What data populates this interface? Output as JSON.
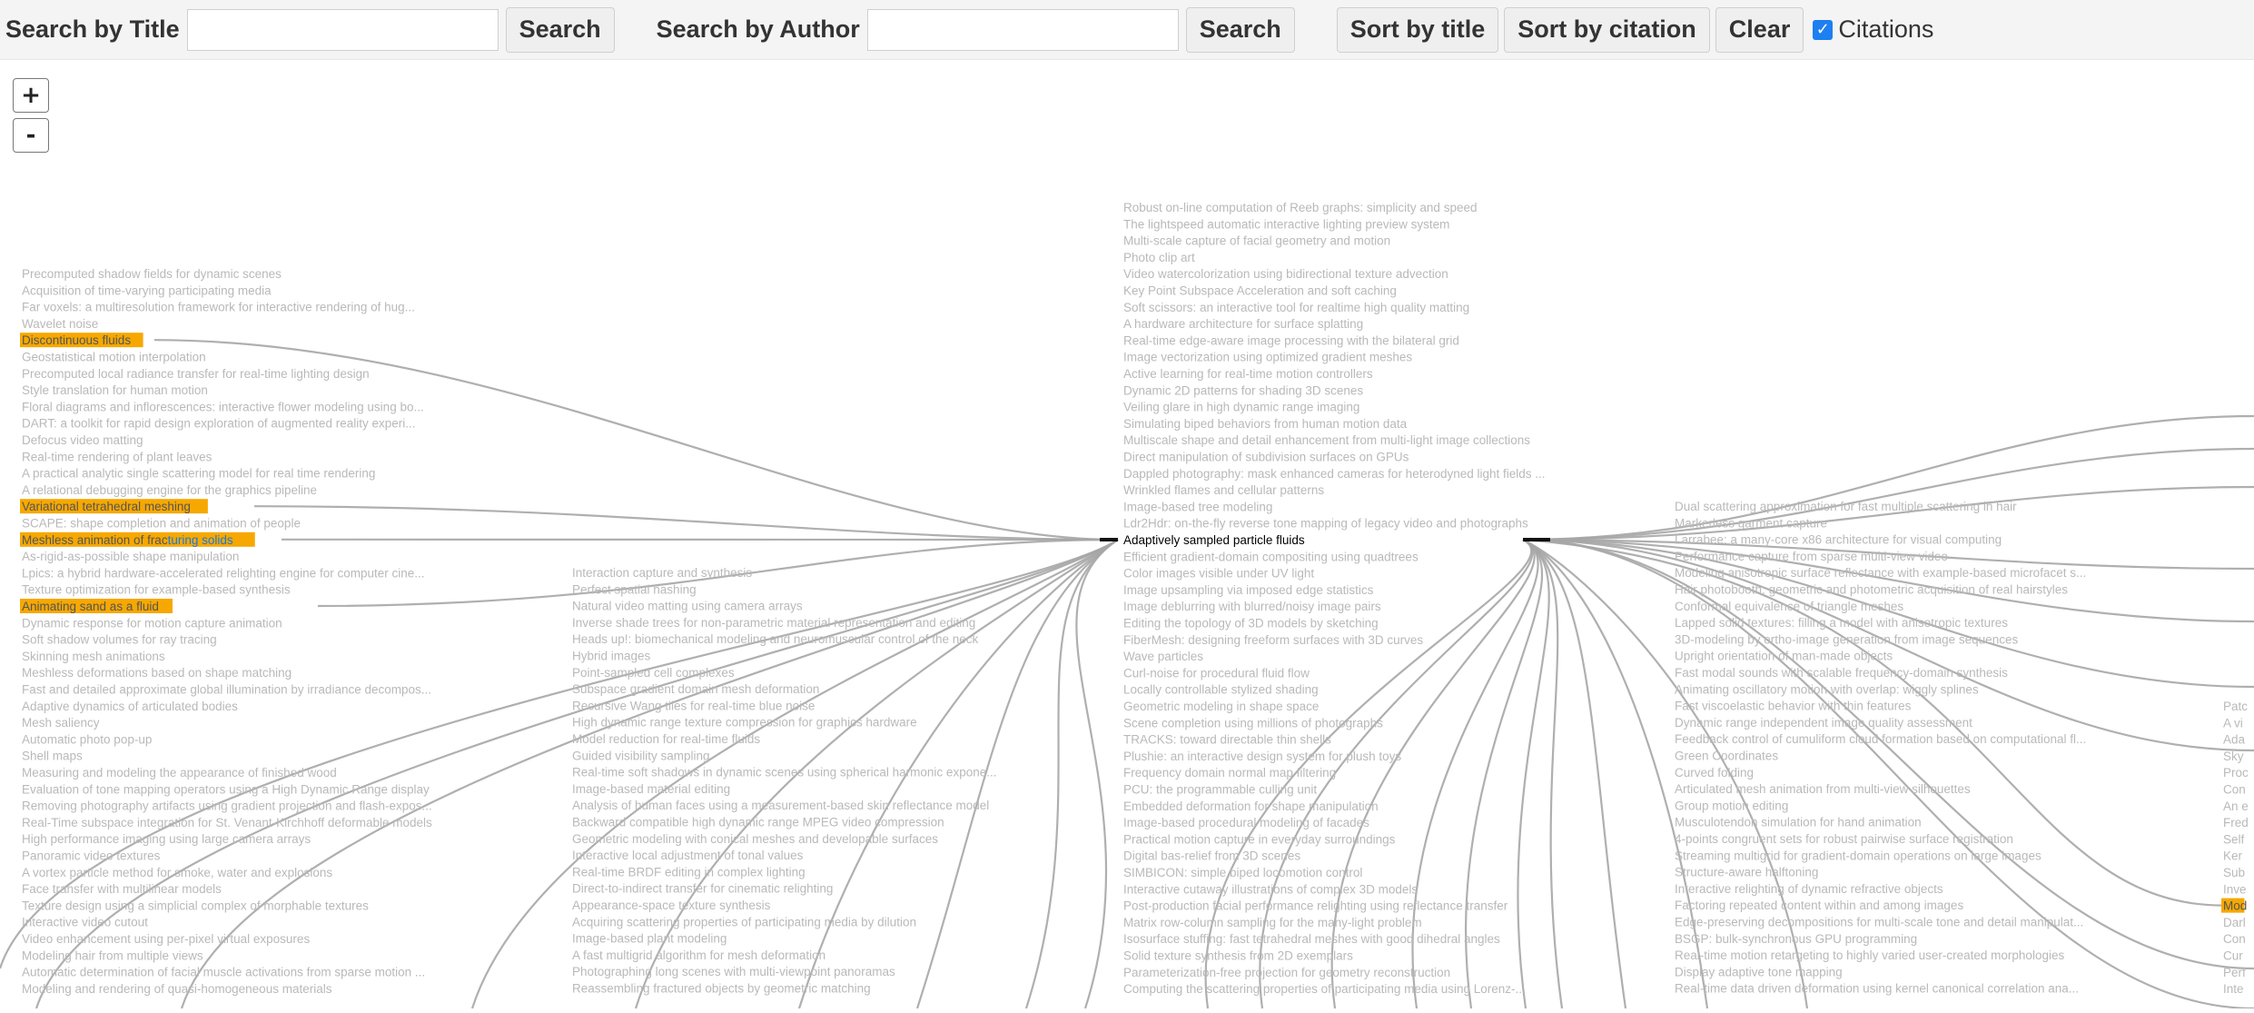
{
  "toolbar": {
    "title_label": "Search by Title",
    "title_value": "",
    "title_button": "Search",
    "author_label": "Search by Author",
    "author_value": "",
    "author_button": "Search",
    "sort_title": "Sort by title",
    "sort_citation": "Sort by citation",
    "clear": "Clear",
    "citations_checked": true,
    "citations_label": "Citations"
  },
  "zoom": {
    "in": "+",
    "out": "-"
  },
  "colors": {
    "text_gray": "#b9b9b9",
    "edge_gray": "#a6a6a6",
    "highlight": "#f7a800",
    "link_blue": "#1a7ad9",
    "center_edge": "#000000"
  },
  "graph": {
    "center": {
      "title": "Adaptively sampled particle fluids"
    },
    "columns": [
      {
        "id": "col1",
        "items": [
          "Precomputed shadow fields for dynamic scenes",
          "Acquisition of time-varying participating media",
          "Far voxels: a multiresolution framework for interactive rendering of hug...",
          "Wavelet noise",
          "Discontinuous fluids",
          "Geostatistical motion interpolation",
          "Precomputed local radiance transfer for real-time lighting design",
          "Style translation for human motion",
          "Floral diagrams and inflorescences: interactive flower modeling using bo...",
          "DART: a toolkit for rapid design exploration of augmented reality experi...",
          "Defocus video matting",
          "Real-time rendering of plant leaves",
          "A practical analytic single scattering model for real time rendering",
          "A relational debugging engine for the graphics pipeline",
          "Variational tetrahedral meshing",
          "SCAPE: shape completion and animation of people",
          "Meshless animation of fracturing solids",
          "As-rigid-as-possible shape manipulation",
          "Lpics: a hybrid hardware-accelerated relighting engine for computer cine...",
          "Texture optimization for example-based synthesis",
          "Animating sand as a fluid",
          "Dynamic response for motion capture animation",
          "Soft shadow volumes for ray tracing",
          "Skinning mesh animations",
          "Meshless deformations based on shape matching",
          "Fast and detailed approximate global illumination by irradiance decompos...",
          "Adaptive dynamics of articulated bodies",
          "Mesh saliency",
          "Automatic photo pop-up",
          "Shell maps",
          "Measuring and modeling the appearance of finished wood",
          "Evaluation of tone mapping operators using a High Dynamic Range display",
          "Removing photography artifacts using gradient projection and flash-expos...",
          "Real-Time subspace integration for St. Venant-Kirchhoff deformable models",
          "High performance imaging using large camera arrays",
          "Panoramic video textures",
          "A vortex particle method for smoke, water and explosions",
          "Face transfer with multilinear models",
          "Texture design using a simplicial complex of morphable textures",
          "Interactive video cutout",
          "Video enhancement using per-pixel virtual exposures",
          "Modeling hair from multiple views",
          "Automatic determination of facial muscle activations from sparse motion ...",
          "Modeling and rendering of quasi-homogeneous materials"
        ],
        "highlighted": [
          4,
          14,
          16,
          20
        ],
        "cited_link": {
          "index": 16,
          "prefix": "Meshless animation of frac",
          "suffix": "turing solids"
        }
      },
      {
        "id": "col2",
        "items": [
          "Interaction capture and synthesis",
          "Perfect spatial hashing",
          "Natural video matting using camera arrays",
          "Inverse shade trees for non-parametric material representation and editing",
          "Heads up!: biomechanical modeling and neuromuscular control of the neck",
          "Hybrid images",
          "Point-sampled cell complexes",
          "Subspace gradient domain mesh deformation",
          "Recursive Wang tiles for real-time blue noise",
          "High dynamic range texture compression for graphics hardware",
          "Model reduction for real-time fluids",
          "Guided visibility sampling",
          "Real-time soft shadows in dynamic scenes using spherical harmonic expone...",
          "Image-based material editing",
          "Analysis of human faces using a measurement-based skin reflectance model",
          "Backward compatible high dynamic range MPEG video compression",
          "Geometric modeling with conical meshes and developable surfaces",
          "Interactive local adjustment of tonal values",
          "Real-time BRDF editing in complex lighting",
          "Direct-to-indirect transfer for cinematic relighting",
          "Appearance-space texture synthesis",
          "Acquiring scattering properties of participating media by dilution",
          "Image-based plant modeling",
          "A fast multigrid algorithm for mesh deformation",
          "Photographing long scenes with multi-viewpoint panoramas",
          "Reassembling fractured objects by geometric matching"
        ]
      },
      {
        "id": "col3",
        "items": [
          "Robust on-line computation of Reeb graphs: simplicity and speed",
          "The lightspeed automatic interactive lighting preview system",
          "Multi-scale capture of facial geometry and motion",
          "Photo clip art",
          "Video watercolorization using bidirectional texture advection",
          "Key Point Subspace Acceleration and soft caching",
          "Soft scissors: an interactive tool for realtime high quality matting",
          "A hardware architecture for surface splatting",
          "Real-time edge-aware image processing with the bilateral grid",
          "Image vectorization using optimized gradient meshes",
          "Active learning for real-time motion controllers",
          "Dynamic 2D patterns for shading 3D scenes",
          "Veiling glare in high dynamic range imaging",
          "Simulating biped behaviors from human motion data",
          "Multiscale shape and detail enhancement from multi-light image collections",
          "Direct manipulation of subdivision surfaces on GPUs",
          "Dappled photography: mask enhanced cameras for heterodyned light fields ...",
          "Wrinkled flames and cellular patterns",
          "Image-based tree modeling",
          "Ldr2Hdr: on-the-fly reverse tone mapping of legacy video and photographs",
          "Adaptively sampled particle fluids",
          "Efficient gradient-domain compositing using quadtrees",
          "Color images visible under UV light",
          "Image upsampling via imposed edge statistics",
          "Image deblurring with blurred/noisy image pairs",
          "Editing the topology of 3D models by sketching",
          "FiberMesh: designing freeform surfaces with 3D curves",
          "Wave particles",
          "Curl-noise for procedural fluid flow",
          "Locally controllable stylized shading",
          "Geometric modeling in shape space",
          "Scene completion using millions of photographs",
          "TRACKS: toward directable thin shells",
          "Plushie: an interactive design system for plush toys",
          "Frequency domain normal map filtering",
          "PCU: the programmable culling unit",
          "Embedded deformation for shape manipulation",
          "Image-based procedural modeling of facades",
          "Practical motion capture in everyday surroundings",
          "Digital bas-relief from 3D scenes",
          "SIMBICON: simple biped locomotion control",
          "Interactive cutaway illustrations of complex 3D models",
          "Post-production facial performance relighting using reflectance transfer",
          "Matrix row-column sampling for the many-light problem",
          "Isosurface stuffing: fast tetrahedral meshes with good dihedral angles",
          "Solid texture synthesis from 2D exemplars",
          "Parameterization-free projection for geometry reconstruction",
          "Computing the scattering properties of participating media using Lorenz-..."
        ],
        "center_index": 20
      },
      {
        "id": "col4",
        "items": [
          "Dual scattering approximation for fast multiple scattering in hair",
          "Markerless garment capture",
          "Larrabee: a many-core x86 architecture for visual computing",
          "Performance capture from sparse multi-view video",
          "Modeling anisotropic surface reflectance with example-based microfacet s...",
          "Hair photobooth: geometric and photometric acquisition of real hairstyles",
          "Conformal equivalence of triangle meshes",
          "Lapped solid textures: filling a model with anisotropic textures",
          "3D-modeling by ortho-image generation from image sequences",
          "Upright orientation of man-made objects",
          "Fast modal sounds with scalable frequency-domain synthesis",
          "Animating oscillatory motion with overlap: wiggly splines",
          "Fast viscoelastic behavior with thin features",
          "Dynamic range independent image quality assessment",
          "Feedback control of cumuliform cloud formation based on computational fl...",
          "Green Coordinates",
          "Curved folding",
          "Articulated mesh animation from multi-view silhouettes",
          "Group motion editing",
          "Musculotendon simulation for hand animation",
          "4-points congruent sets for robust pairwise surface registration",
          "Streaming multigrid for gradient-domain operations on large images",
          "Structure-aware halftoning",
          "Interactive relighting of dynamic refractive objects",
          "Factoring repeated content within and among images",
          "Edge-preserving decompositions for multi-scale tone and detail manipulat...",
          "BSGP: bulk-synchronous GPU programming",
          "Real-time motion retargeting to highly varied user-created morphologies",
          "Display adaptive tone mapping",
          "Real-time data driven deformation using kernel canonical correlation ana..."
        ]
      },
      {
        "id": "col5",
        "items": [
          "Patc",
          "A vi",
          "Ada",
          "Sky",
          "Proc",
          "Con",
          "An e",
          "Fred",
          "Self",
          "Ker",
          "Sub",
          "Inve",
          "Mod",
          "Darl",
          "Con",
          "Cur",
          "Perf",
          "Inte"
        ],
        "highlighted": [
          12
        ]
      }
    ]
  }
}
